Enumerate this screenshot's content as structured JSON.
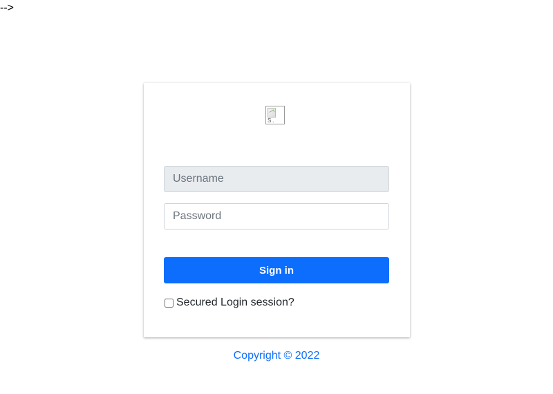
{
  "stray_comment_text": "-->",
  "logo": {
    "icon": "broken-image-icon",
    "alt_fragment": "S.."
  },
  "form": {
    "username_placeholder": "Username",
    "username_value": "",
    "password_placeholder": "Password",
    "password_value": "",
    "signin_label": "Sign in",
    "remember_label": "Secured Login session?",
    "remember_checked": false
  },
  "footer": {
    "copyright": "Copyright © 2022"
  },
  "colors": {
    "accent": "#0d6efd",
    "username_bg": "#e9ecef",
    "border": "#ced4da"
  }
}
